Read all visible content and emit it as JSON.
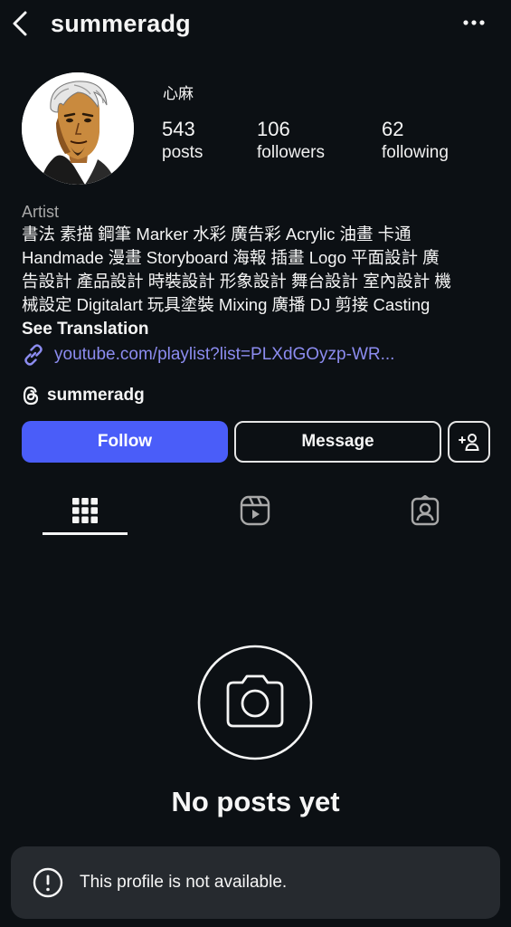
{
  "header": {
    "username": "summeradg"
  },
  "profile": {
    "display_name": "心麻",
    "stats": [
      {
        "value": "543",
        "label": "posts"
      },
      {
        "value": "106",
        "label": "followers"
      },
      {
        "value": "62",
        "label": "following"
      }
    ],
    "category": "Artist",
    "bio_lines": [
      "書法 素描 鋼筆 Marker 水彩 廣告彩 Acrylic 油畫 卡通",
      "Handmade 漫畫 Storyboard 海報 插畫 Logo 平面設計 廣",
      "告設計 產品設計 時裝設計 形象設計 舞台設計 室內設計 機",
      "械設定 Digitalart 玩具塗裝 Mixing 廣播 DJ 剪接 Casting"
    ],
    "see_translation": "See Translation",
    "link": "youtube.com/playlist?list=PLXdGOyzp-WR...",
    "threads_handle": "summeradg"
  },
  "actions": {
    "follow": "Follow",
    "message": "Message"
  },
  "tabs": [
    {
      "name": "posts-grid",
      "icon": "grid-icon",
      "active": true
    },
    {
      "name": "reels",
      "icon": "reels-icon",
      "active": false
    },
    {
      "name": "tagged",
      "icon": "tagged-person-icon",
      "active": false
    }
  ],
  "empty_state": {
    "icon": "camera-icon",
    "text": "No posts yet"
  },
  "toast": {
    "icon": "exclamation-circle-icon",
    "text": "This profile is not available."
  },
  "colors": {
    "background": "#0c1014",
    "follow_button": "#4a5df9",
    "link": "#8c8cf0",
    "toast_background": "#262a2f"
  }
}
